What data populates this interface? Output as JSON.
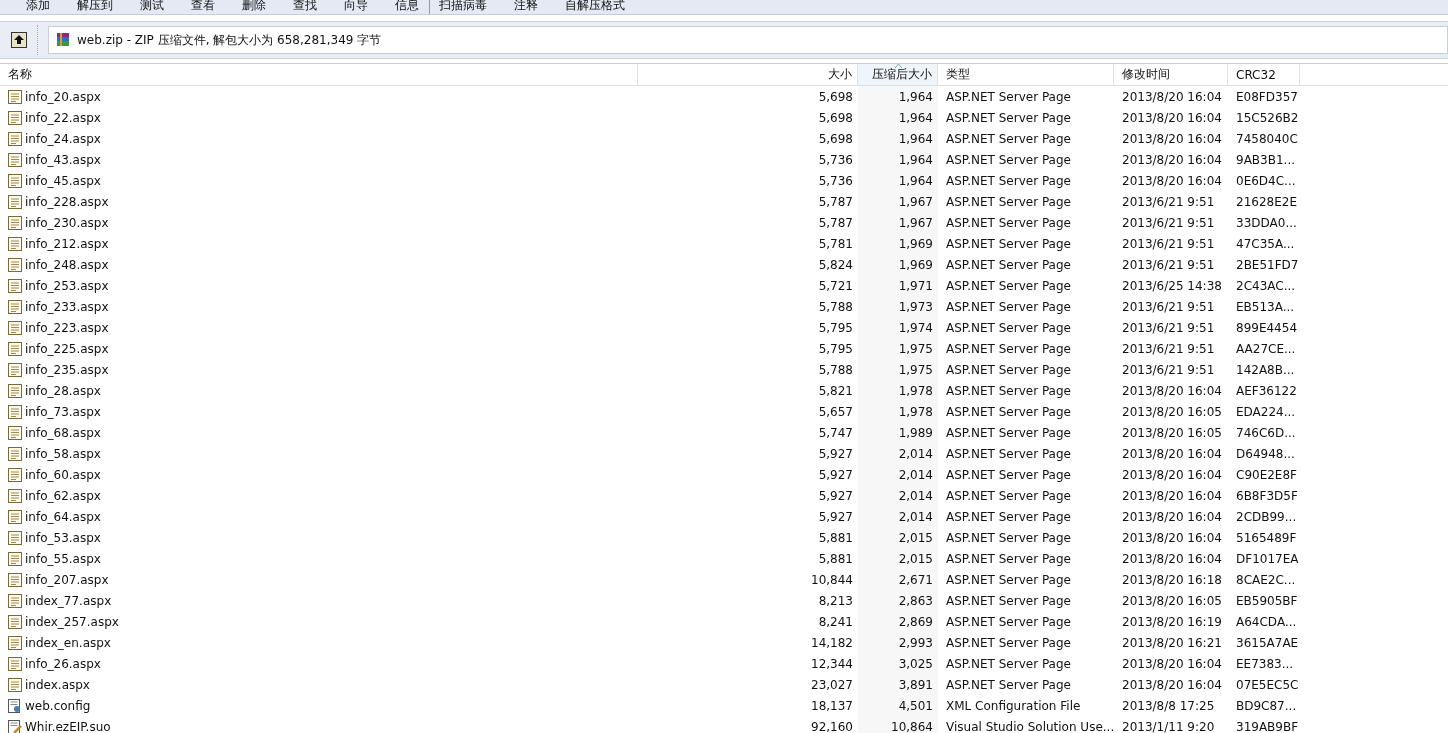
{
  "toolbar": [
    {
      "label": "添加",
      "separator_before": false
    },
    {
      "label": "解压到",
      "separator_before": false
    },
    {
      "label": "测试",
      "separator_before": false
    },
    {
      "label": "查看",
      "separator_before": false
    },
    {
      "label": "删除",
      "separator_before": false
    },
    {
      "label": "查找",
      "separator_before": false
    },
    {
      "label": "向导",
      "separator_before": false
    },
    {
      "label": "信息",
      "separator_before": false
    },
    {
      "label": "扫描病毒",
      "separator_before": true
    },
    {
      "label": "注释",
      "separator_before": false
    },
    {
      "label": "自解压格式",
      "separator_before": false
    }
  ],
  "address": "web.zip - ZIP 压缩文件, 解包大小为 658,281,349 字节",
  "columns": [
    {
      "label": "名称",
      "sorted": false
    },
    {
      "label": "大小",
      "sorted": false
    },
    {
      "label": "压缩后大小",
      "sorted": true
    },
    {
      "label": "类型",
      "sorted": false
    },
    {
      "label": "修改时间",
      "sorted": false
    },
    {
      "label": "CRC32",
      "sorted": false
    }
  ],
  "rows": [
    {
      "kind": "aspx",
      "name": "info_20.aspx",
      "size": "5,698",
      "packed": "1,964",
      "type": "ASP.NET Server Page",
      "modified": "2013/8/20 16:04",
      "crc": "E08FD357"
    },
    {
      "kind": "aspx",
      "name": "info_22.aspx",
      "size": "5,698",
      "packed": "1,964",
      "type": "ASP.NET Server Page",
      "modified": "2013/8/20 16:04",
      "crc": "15C526B2"
    },
    {
      "kind": "aspx",
      "name": "info_24.aspx",
      "size": "5,698",
      "packed": "1,964",
      "type": "ASP.NET Server Page",
      "modified": "2013/8/20 16:04",
      "crc": "7458040C"
    },
    {
      "kind": "aspx",
      "name": "info_43.aspx",
      "size": "5,736",
      "packed": "1,964",
      "type": "ASP.NET Server Page",
      "modified": "2013/8/20 16:04",
      "crc": "9AB3B1..."
    },
    {
      "kind": "aspx",
      "name": "info_45.aspx",
      "size": "5,736",
      "packed": "1,964",
      "type": "ASP.NET Server Page",
      "modified": "2013/8/20 16:04",
      "crc": "0E6D4C..."
    },
    {
      "kind": "aspx",
      "name": "info_228.aspx",
      "size": "5,787",
      "packed": "1,967",
      "type": "ASP.NET Server Page",
      "modified": "2013/6/21 9:51",
      "crc": "21628E2E"
    },
    {
      "kind": "aspx",
      "name": "info_230.aspx",
      "size": "5,787",
      "packed": "1,967",
      "type": "ASP.NET Server Page",
      "modified": "2013/6/21 9:51",
      "crc": "33DDA0..."
    },
    {
      "kind": "aspx",
      "name": "info_212.aspx",
      "size": "5,781",
      "packed": "1,969",
      "type": "ASP.NET Server Page",
      "modified": "2013/6/21 9:51",
      "crc": "47C35A..."
    },
    {
      "kind": "aspx",
      "name": "info_248.aspx",
      "size": "5,824",
      "packed": "1,969",
      "type": "ASP.NET Server Page",
      "modified": "2013/6/21 9:51",
      "crc": "2BE51FD7"
    },
    {
      "kind": "aspx",
      "name": "info_253.aspx",
      "size": "5,721",
      "packed": "1,971",
      "type": "ASP.NET Server Page",
      "modified": "2013/6/25 14:38",
      "crc": "2C43AC..."
    },
    {
      "kind": "aspx",
      "name": "info_233.aspx",
      "size": "5,788",
      "packed": "1,973",
      "type": "ASP.NET Server Page",
      "modified": "2013/6/21 9:51",
      "crc": "EB513A..."
    },
    {
      "kind": "aspx",
      "name": "info_223.aspx",
      "size": "5,795",
      "packed": "1,974",
      "type": "ASP.NET Server Page",
      "modified": "2013/6/21 9:51",
      "crc": "899E4454"
    },
    {
      "kind": "aspx",
      "name": "info_225.aspx",
      "size": "5,795",
      "packed": "1,975",
      "type": "ASP.NET Server Page",
      "modified": "2013/6/21 9:51",
      "crc": "AA27CE..."
    },
    {
      "kind": "aspx",
      "name": "info_235.aspx",
      "size": "5,788",
      "packed": "1,975",
      "type": "ASP.NET Server Page",
      "modified": "2013/6/21 9:51",
      "crc": "142A8B..."
    },
    {
      "kind": "aspx",
      "name": "info_28.aspx",
      "size": "5,821",
      "packed": "1,978",
      "type": "ASP.NET Server Page",
      "modified": "2013/8/20 16:04",
      "crc": "AEF36122"
    },
    {
      "kind": "aspx",
      "name": "info_73.aspx",
      "size": "5,657",
      "packed": "1,978",
      "type": "ASP.NET Server Page",
      "modified": "2013/8/20 16:05",
      "crc": "EDA224..."
    },
    {
      "kind": "aspx",
      "name": "info_68.aspx",
      "size": "5,747",
      "packed": "1,989",
      "type": "ASP.NET Server Page",
      "modified": "2013/8/20 16:05",
      "crc": "746C6D..."
    },
    {
      "kind": "aspx",
      "name": "info_58.aspx",
      "size": "5,927",
      "packed": "2,014",
      "type": "ASP.NET Server Page",
      "modified": "2013/8/20 16:04",
      "crc": "D64948..."
    },
    {
      "kind": "aspx",
      "name": "info_60.aspx",
      "size": "5,927",
      "packed": "2,014",
      "type": "ASP.NET Server Page",
      "modified": "2013/8/20 16:04",
      "crc": "C90E2E8F"
    },
    {
      "kind": "aspx",
      "name": "info_62.aspx",
      "size": "5,927",
      "packed": "2,014",
      "type": "ASP.NET Server Page",
      "modified": "2013/8/20 16:04",
      "crc": "6B8F3D5F"
    },
    {
      "kind": "aspx",
      "name": "info_64.aspx",
      "size": "5,927",
      "packed": "2,014",
      "type": "ASP.NET Server Page",
      "modified": "2013/8/20 16:04",
      "crc": "2CDB99..."
    },
    {
      "kind": "aspx",
      "name": "info_53.aspx",
      "size": "5,881",
      "packed": "2,015",
      "type": "ASP.NET Server Page",
      "modified": "2013/8/20 16:04",
      "crc": "5165489F"
    },
    {
      "kind": "aspx",
      "name": "info_55.aspx",
      "size": "5,881",
      "packed": "2,015",
      "type": "ASP.NET Server Page",
      "modified": "2013/8/20 16:04",
      "crc": "DF1017EA"
    },
    {
      "kind": "aspx",
      "name": "info_207.aspx",
      "size": "10,844",
      "packed": "2,671",
      "type": "ASP.NET Server Page",
      "modified": "2013/8/20 16:18",
      "crc": "8CAE2C..."
    },
    {
      "kind": "aspx",
      "name": "index_77.aspx",
      "size": "8,213",
      "packed": "2,863",
      "type": "ASP.NET Server Page",
      "modified": "2013/8/20 16:05",
      "crc": "EB5905BF"
    },
    {
      "kind": "aspx",
      "name": "index_257.aspx",
      "size": "8,241",
      "packed": "2,869",
      "type": "ASP.NET Server Page",
      "modified": "2013/8/20 16:19",
      "crc": "A64CDA..."
    },
    {
      "kind": "aspx",
      "name": "index_en.aspx",
      "size": "14,182",
      "packed": "2,993",
      "type": "ASP.NET Server Page",
      "modified": "2013/8/20 16:21",
      "crc": "3615A7AE"
    },
    {
      "kind": "aspx",
      "name": "info_26.aspx",
      "size": "12,344",
      "packed": "3,025",
      "type": "ASP.NET Server Page",
      "modified": "2013/8/20 16:04",
      "crc": "EE7383..."
    },
    {
      "kind": "aspx",
      "name": "index.aspx",
      "size": "23,027",
      "packed": "3,891",
      "type": "ASP.NET Server Page",
      "modified": "2013/8/20 16:04",
      "crc": "07E5EC5C"
    },
    {
      "kind": "config",
      "name": "web.config",
      "size": "18,137",
      "packed": "4,501",
      "type": "XML Configuration File",
      "modified": "2013/8/8 17:25",
      "crc": "BD9C87..."
    },
    {
      "kind": "suo",
      "name": "Whir.ezEIP.suo",
      "size": "92,160",
      "packed": "10,864",
      "type": "Visual Studio Solution Use...",
      "modified": "2013/1/11 9:20",
      "crc": "319AB9BF"
    }
  ]
}
